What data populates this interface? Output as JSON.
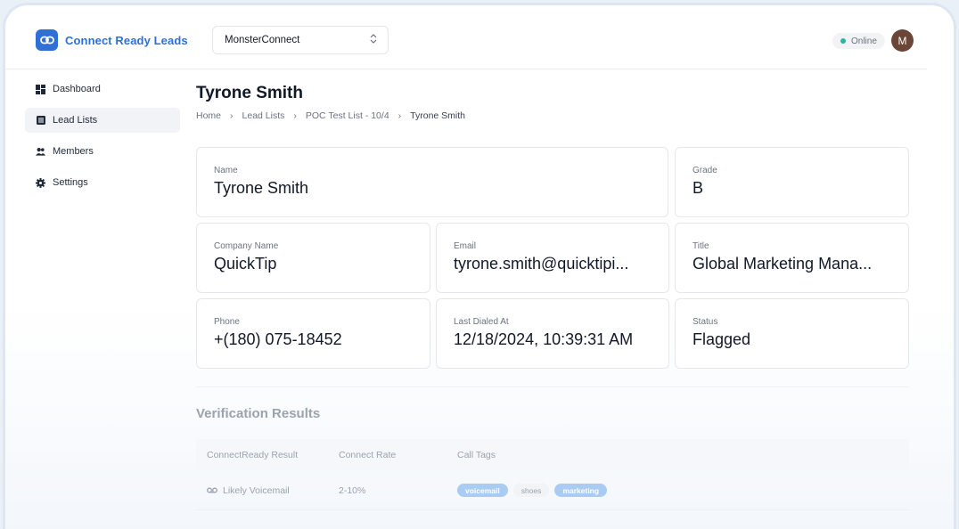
{
  "brand": {
    "name": "Connect Ready Leads",
    "logo_icon": "link-icon",
    "accent": "#2f6fd6"
  },
  "org_select": {
    "value": "MonsterConnect"
  },
  "status": {
    "label": "Online",
    "color": "#2bb5a0"
  },
  "user": {
    "initial": "M"
  },
  "sidebar": {
    "items": [
      {
        "label": "Dashboard",
        "icon": "dashboard-icon",
        "active": false
      },
      {
        "label": "Lead Lists",
        "icon": "list-icon",
        "active": true
      },
      {
        "label": "Members",
        "icon": "members-icon",
        "active": false
      },
      {
        "label": "Settings",
        "icon": "gear-icon",
        "active": false
      }
    ]
  },
  "page": {
    "title": "Tyrone Smith",
    "breadcrumb": [
      "Home",
      "Lead Lists",
      "POC Test List - 10/4",
      "Tyrone Smith"
    ]
  },
  "fields": {
    "name": {
      "label": "Name",
      "value": "Tyrone Smith"
    },
    "grade": {
      "label": "Grade",
      "value": "B"
    },
    "company": {
      "label": "Company Name",
      "value": "QuickTip"
    },
    "email": {
      "label": "Email",
      "value": "tyrone.smith@quicktipi..."
    },
    "title": {
      "label": "Title",
      "value": "Global Marketing Mana..."
    },
    "phone": {
      "label": "Phone",
      "value": "+(180) 075-18452"
    },
    "last_dialed": {
      "label": "Last Dialed At",
      "value": "12/18/2024, 10:39:31 AM"
    },
    "status": {
      "label": "Status",
      "value": "Flagged"
    }
  },
  "verification": {
    "title": "Verification Results",
    "columns": [
      "ConnectReady Result",
      "Connect Rate",
      "Call Tags"
    ],
    "rows": [
      {
        "result": "Likely Voicemail",
        "result_icon": "voicemail-icon",
        "rate": "2-10%",
        "tags": [
          {
            "label": "voicemail",
            "style": "blue"
          },
          {
            "label": "shoes",
            "style": "gray"
          },
          {
            "label": "marketing",
            "style": "blue"
          }
        ]
      }
    ]
  }
}
